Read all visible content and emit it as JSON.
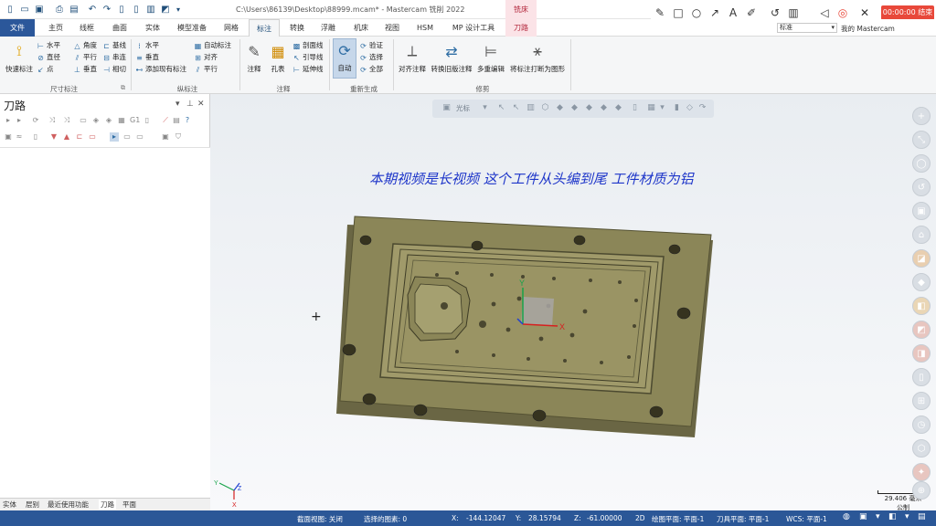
{
  "window": {
    "title": "C:\\Users\\86139\\Desktop\\88999.mcam* - Mastercam 铣削 2022",
    "context_tab": "铣床"
  },
  "recorder": {
    "icons": [
      "pen-icon",
      "square-icon",
      "circle-icon",
      "arrow-icon",
      "text-icon",
      "highlighter-icon",
      "undo-icon",
      "trash-icon",
      "speaker-icon",
      "mic-off-icon",
      "close-icon"
    ],
    "timer_label": "00:00:00 结束"
  },
  "tabs": [
    "文件",
    "主页",
    "线框",
    "曲面",
    "实体",
    "模型准备",
    "网格",
    "标注",
    "转换",
    "浮雕",
    "机床",
    "视图",
    "HSM",
    "MP 设计工具",
    "刀路"
  ],
  "active_tab": "标注",
  "ribbon": {
    "dim_group": {
      "label": "尺寸标注",
      "quick_dim": "快速标注",
      "items": [
        "水平",
        "角度",
        "基线",
        "直径",
        "平行",
        "串连",
        "点",
        "垂直",
        "相切"
      ]
    },
    "ord_group": {
      "label": "纵标注",
      "items": [
        "水平",
        "自动标注",
        "垂直",
        "对齐",
        "添加现有标注",
        "平行"
      ]
    },
    "note_group": {
      "label": "注释",
      "note": "注释",
      "hole_table": "孔表",
      "items": [
        "剖面线",
        "引导线",
        "延伸线"
      ]
    },
    "regen_group": {
      "label": "重新生成",
      "auto": "自动",
      "items": [
        "验证",
        "选择",
        "全部"
      ]
    },
    "modify_group": {
      "label": "修剪",
      "items": [
        "对齐注释",
        "转换旧版注释",
        "多重编辑",
        "将标注打断为图形"
      ]
    },
    "search_placeholder": "标准",
    "my_mastercam": "我的 Mastercam"
  },
  "panel": {
    "title": "刀路",
    "bottom_tabs": [
      "实体",
      "层别",
      "最近使用功能",
      "刀路",
      "平面"
    ]
  },
  "viewport": {
    "toolbar_label": "光标",
    "annotation": "本期视频是长视频 这个工件从头编到尾 工件材质为铝",
    "gnomon": {
      "x": "X",
      "y": "Y",
      "z": "Z"
    },
    "scale": {
      "value": "29.406 毫米",
      "unit": "公制"
    }
  },
  "status": {
    "section_view": "截面视图: 关闭",
    "selected": "选择的图素: 0",
    "x_label": "X:",
    "x_value": "-144.12047",
    "y_label": "Y:",
    "y_value": "28.15794",
    "z_label": "Z:",
    "z_value": "-61.00000",
    "mode": "2D",
    "draw_plane": "绘图平面: 平面-1",
    "tool_plane": "刀具平面: 平面-1",
    "wcs": "WCS: 平面-1"
  },
  "colors": {
    "file_tab": "#2b579a",
    "status_bar": "#2b5797",
    "part_body": "#8b8658",
    "annotation_text": "#1d35c9",
    "record_button": "#e8483a"
  }
}
